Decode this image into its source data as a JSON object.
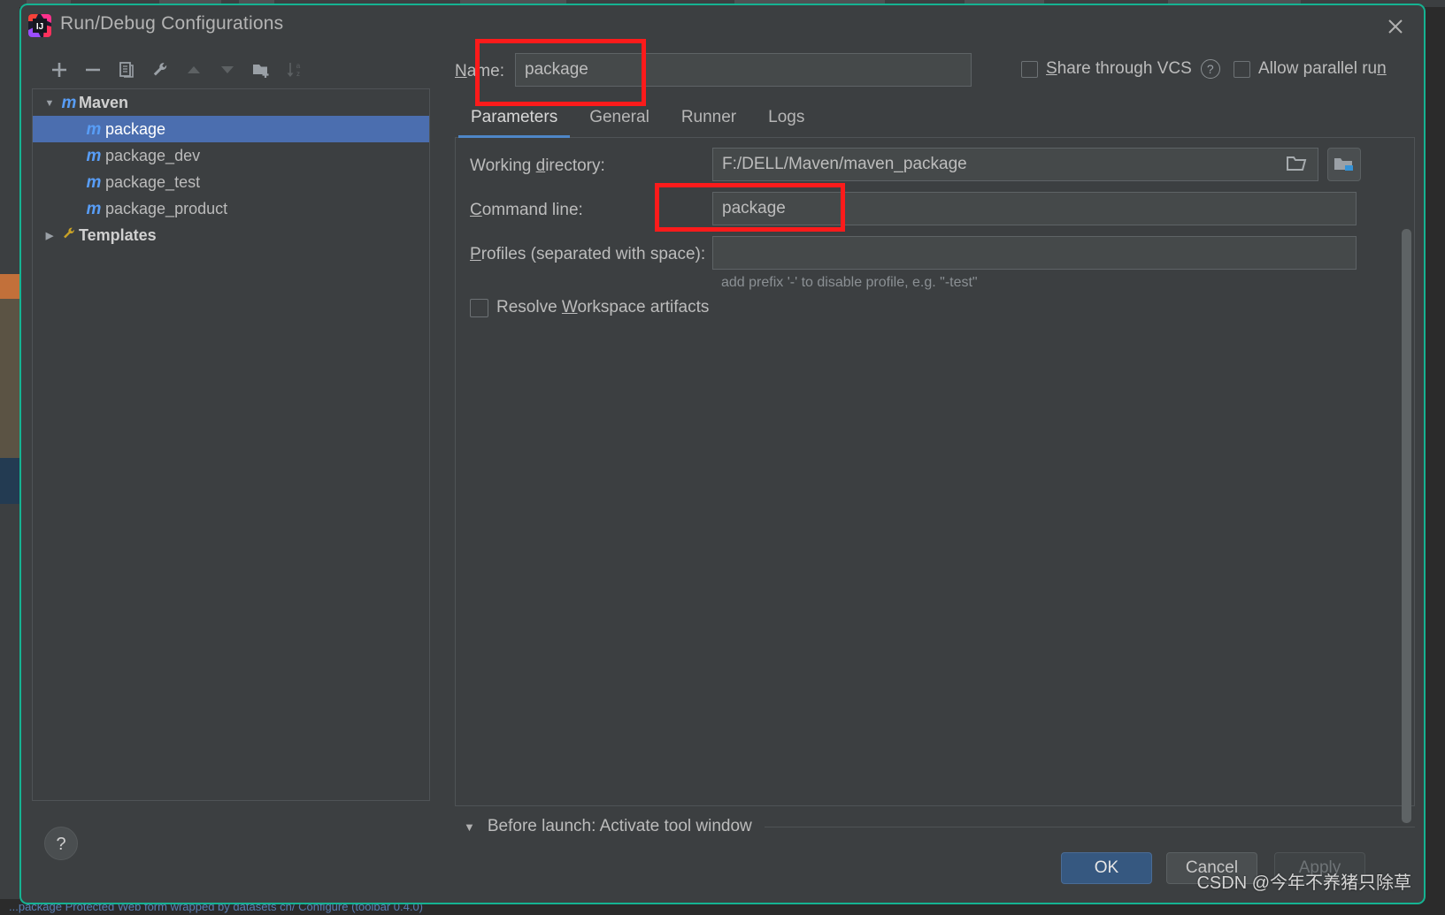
{
  "window": {
    "title": "Run/Debug Configurations",
    "app_icon": "intellij-idea-icon",
    "close_icon": "close-icon",
    "border_color": "#15b392"
  },
  "tree_toolbar": {
    "buttons": [
      {
        "name": "add-configuration-button",
        "icon": "plus-icon",
        "label": "+",
        "enabled": true
      },
      {
        "name": "remove-configuration-button",
        "icon": "minus-icon",
        "label": "−",
        "enabled": true
      },
      {
        "name": "copy-configuration-button",
        "icon": "copy-icon",
        "label": "copy",
        "enabled": true
      },
      {
        "name": "edit-templates-button",
        "icon": "wrench-icon",
        "label": "wrench",
        "enabled": true
      },
      {
        "name": "move-up-button",
        "icon": "triangle-up-icon",
        "label": "▲",
        "enabled": false
      },
      {
        "name": "move-down-button",
        "icon": "triangle-down-icon",
        "label": "▼",
        "enabled": false
      },
      {
        "name": "new-folder-button",
        "icon": "folder-add-icon",
        "label": "folder+",
        "enabled": true
      },
      {
        "name": "sort-alphabetically-button",
        "icon": "sort-az-icon",
        "label": "sort",
        "enabled": false
      }
    ]
  },
  "tree": {
    "items": [
      {
        "label": "Maven",
        "icon": "maven-icon",
        "twisty": "▼",
        "level": 0,
        "group": true,
        "selected": false
      },
      {
        "label": "package",
        "icon": "maven-icon",
        "twisty": "",
        "level": 1,
        "group": false,
        "selected": true
      },
      {
        "label": "package_dev",
        "icon": "maven-icon",
        "twisty": "",
        "level": 1,
        "group": false,
        "selected": false
      },
      {
        "label": "package_test",
        "icon": "maven-icon",
        "twisty": "",
        "level": 1,
        "group": false,
        "selected": false
      },
      {
        "label": "package_product",
        "icon": "maven-icon",
        "twisty": "",
        "level": 1,
        "group": false,
        "selected": false
      },
      {
        "label": "Templates",
        "icon": "wrench-icon",
        "twisty": "▶",
        "level": 0,
        "group": true,
        "selected": false
      }
    ]
  },
  "help_button": {
    "label": "?",
    "icon": "question-mark-icon"
  },
  "name_row": {
    "label": "Name:",
    "value": "package",
    "placeholder": "",
    "share_vcs_label": "Share through VCS",
    "share_vcs_checked": false,
    "help_icon": "question-circle-icon",
    "allow_parallel_label": "Allow parallel run",
    "allow_parallel_checked": false
  },
  "tabs": [
    {
      "label": "Parameters",
      "active": true
    },
    {
      "label": "General",
      "active": false
    },
    {
      "label": "Runner",
      "active": false
    },
    {
      "label": "Logs",
      "active": false
    }
  ],
  "parameters": {
    "working_directory": {
      "label": "Working directory:",
      "value": "F:/DELL/Maven/maven_package",
      "browse_icon": "folder-open-icon",
      "module_button_icon": "module-folder-icon"
    },
    "command_line": {
      "label": "Command line:",
      "value": "package",
      "placeholder": ""
    },
    "profiles": {
      "label": "Profiles (separated with space):",
      "value": "",
      "placeholder": "",
      "hint": "add prefix '-' to disable profile, e.g. \"-test\""
    },
    "resolve_workspace": {
      "label": "Resolve Workspace artifacts",
      "checked": false
    }
  },
  "before_launch": {
    "twisty": "▼",
    "label": "Before launch: Activate tool window"
  },
  "footer": {
    "ok_label": "OK",
    "cancel_label": "Cancel",
    "apply_label": "Apply",
    "apply_enabled": false,
    "ok_color": "#365880"
  },
  "annotations": {
    "color": "#fc1b1b",
    "boxes": [
      {
        "name": "name-field-highlight"
      },
      {
        "name": "command-line-highlight"
      }
    ]
  },
  "watermark": {
    "text": "CSDN @今年不养猪只除草"
  },
  "ide_background": {
    "status_text": "...package Protected Web form wrapped by datasets ch/  Configure  (toolbar 0.4.0)"
  },
  "scrollbar": {
    "name": "vertical-scrollbar",
    "thumb_color": "#5e6365"
  }
}
